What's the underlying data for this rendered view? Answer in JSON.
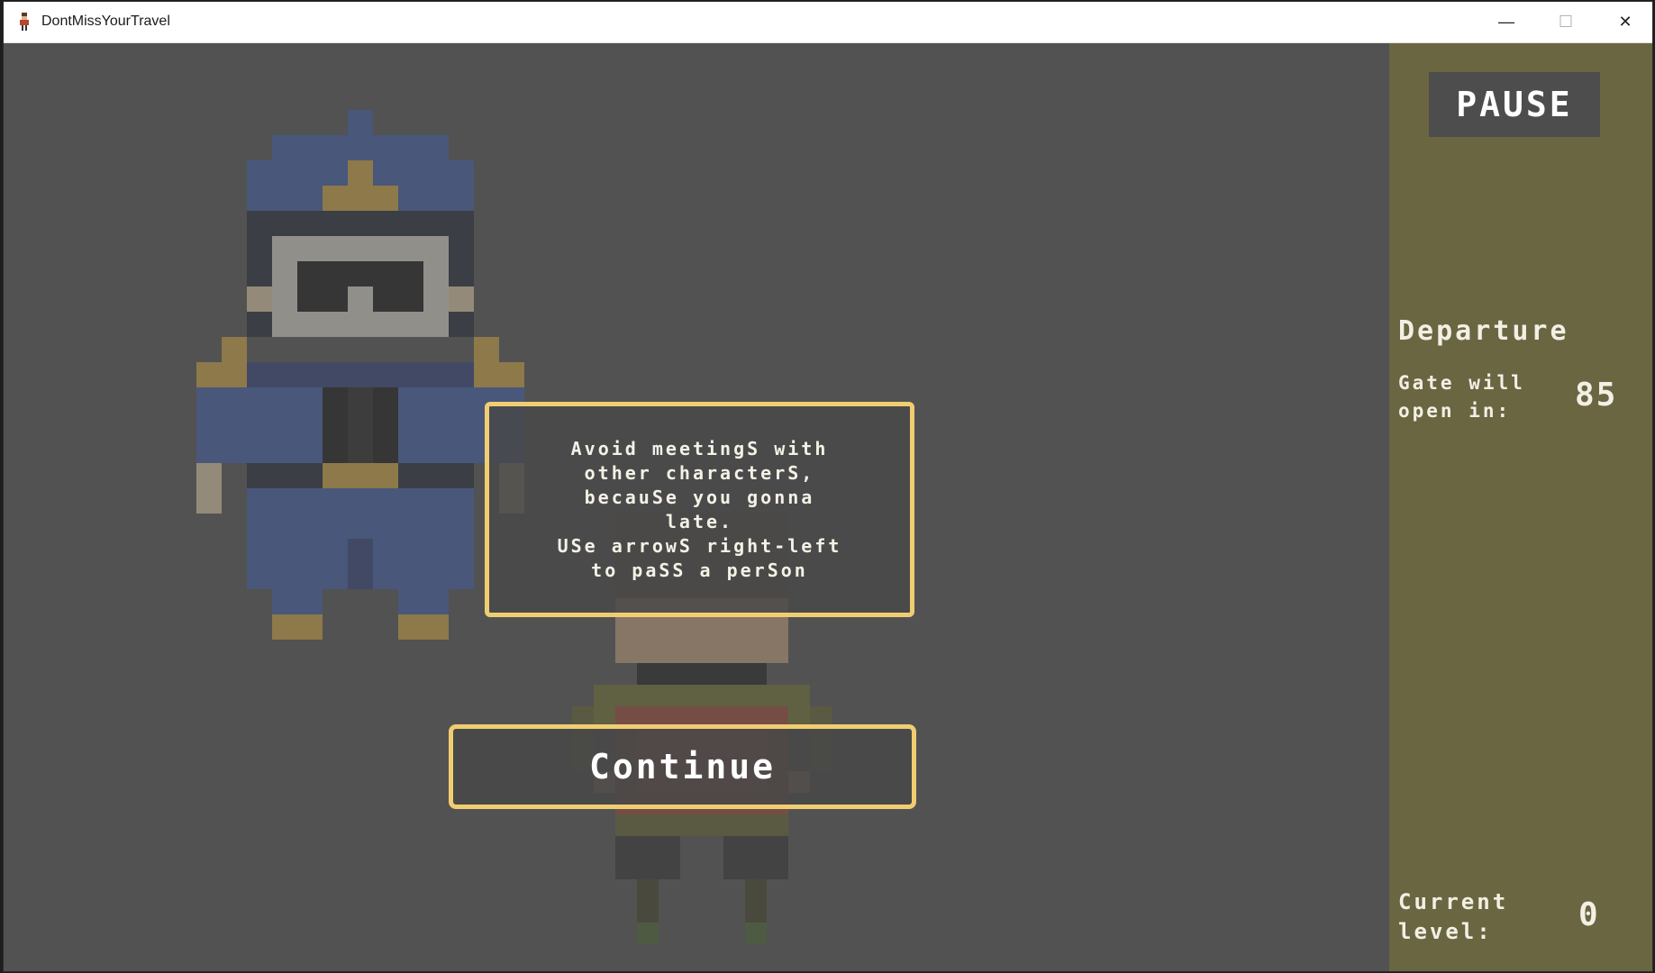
{
  "window": {
    "title": "DontMissYourTravel"
  },
  "title_controls": {
    "minimize": "—",
    "maximize": "☐",
    "close": "✕"
  },
  "hud": {
    "pause_label": "PAUSE",
    "departure_title": "Departure",
    "gate_label": "Gate will open in:",
    "gate_value": "85",
    "level_label": "Current level:",
    "level_value": "0"
  },
  "dialog": {
    "message": "Avoid meetingS with\nother characterS,\nbecauSe you gonna\nlate.\nUSe arrowS right-left\nto paSS a perSon",
    "continue_label": "Continue"
  },
  "icons": {
    "app": "traveler-sprite-icon",
    "officer": "officer-sprite",
    "player": "player-sprite"
  },
  "colors": {
    "background": "#525252",
    "sidebar": "#6a6642",
    "border_accent": "#f1cd72",
    "pause_bg": "#4d4d4d"
  }
}
